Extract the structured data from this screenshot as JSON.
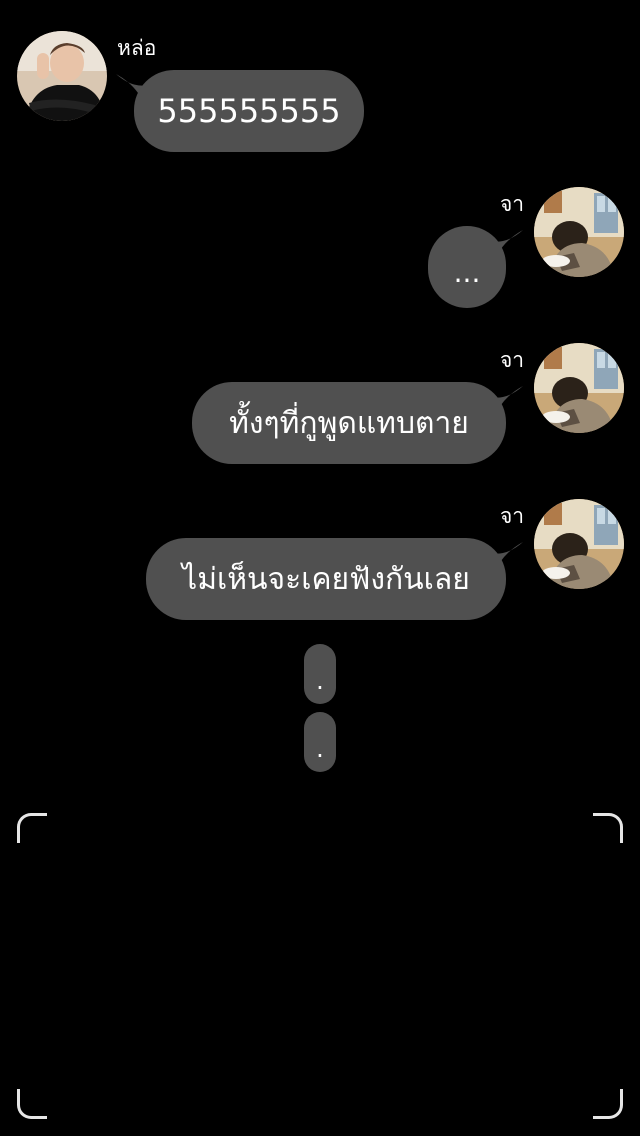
{
  "messages": [
    {
      "sender": "หล่อ",
      "side": "left",
      "text": "555555555"
    },
    {
      "sender": "จา",
      "side": "right",
      "text": "..."
    },
    {
      "sender": "จา",
      "side": "right",
      "text": "ทั้งๆที่กูพูดแทบตาย"
    },
    {
      "sender": "จา",
      "side": "right",
      "text": "ไม่เห็นจะเคยฟังกันเลย"
    }
  ],
  "trailing_dots": [
    ".",
    "."
  ],
  "colors": {
    "background": "#000000",
    "bubble": "#505050",
    "text": "#ffffff",
    "frame_corners": "#e6e6e6"
  },
  "icons": {
    "avatar_left": "avatar-photo",
    "avatar_right": "avatar-photo",
    "frame": "camera-frame-corners"
  }
}
